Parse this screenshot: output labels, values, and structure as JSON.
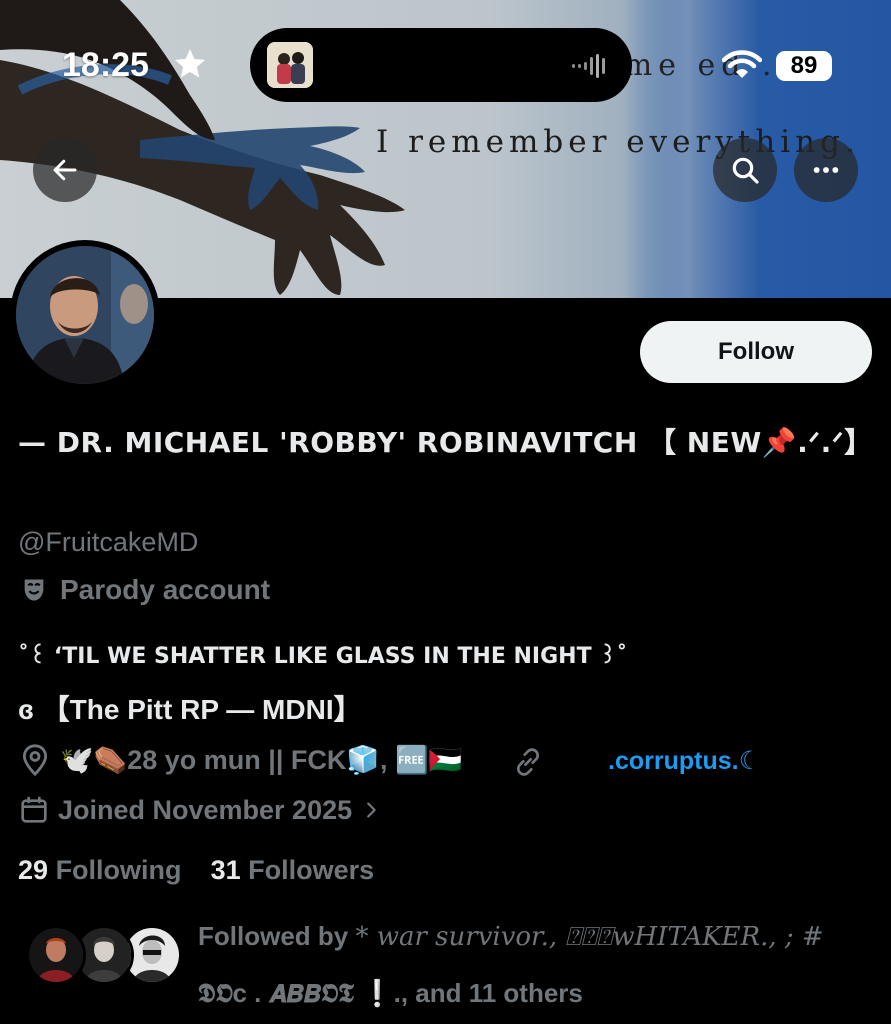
{
  "status_bar": {
    "time": "18:25",
    "battery": "89"
  },
  "banner": {
    "text_line1": "I remember everything.",
    "text_line2": "eme   ed ."
  },
  "profile": {
    "name": "— DR. MICHAEL 'ROBBY' ROBINAVITCH 【 NEW📌.ᐟ.ᐟ】",
    "handle": "@FruitcakeMD",
    "parody_label": "Parody account",
    "bio_line1": "˚꒰ ‘TIL WE SHATTER LIKE GLASS IN THE NIGHT ꒱˚",
    "bio_line2": "ɞ 【The Pitt RP — MDNI】",
    "location": "🕊️⚰️28 yo mun || FCK🧊, 🆓🇵🇸",
    "website": ".corruptus.☾",
    "joined": "Joined November 2025",
    "following_count": "29",
    "following_label": "Following",
    "followers_count": "31",
    "followers_label": "Followers",
    "followed_by_prefix": "Followed by",
    "followed_by_name1": "* war survivor.",
    "followed_by_name2": ", ⍰⍰⍰wHITAKER., ; #",
    "followed_by_name3": "𝕯𝕺c . 𝘼𝘽𝘽𝕺𝕿 ❕",
    "followed_by_suffix": "., and 11 others"
  },
  "buttons": {
    "follow": "Follow"
  },
  "icons": [
    "star-icon",
    "wifi-icon",
    "back-arrow-icon",
    "search-icon",
    "more-icon",
    "theater-mask-icon",
    "location-pin-icon",
    "link-icon",
    "calendar-icon",
    "chevron-right-icon"
  ],
  "colors": {
    "background": "#000000",
    "accent_link": "#1d9bf0",
    "secondary_text": "#71767b",
    "follow_button_bg": "#eff3f4"
  }
}
